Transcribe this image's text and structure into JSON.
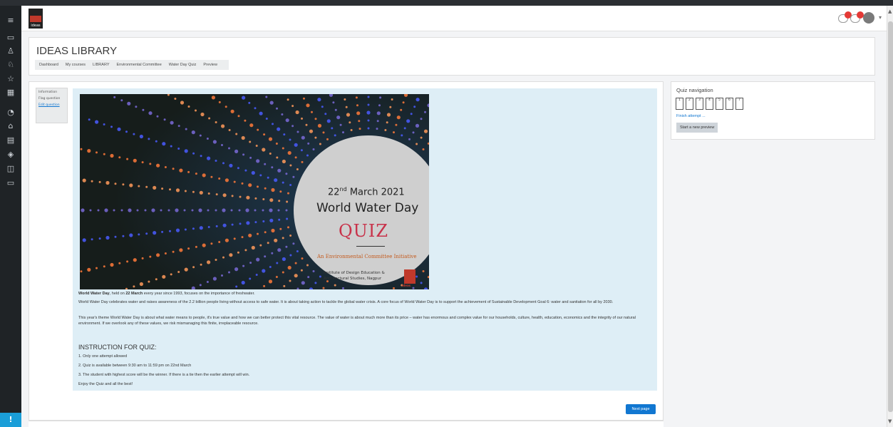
{
  "app": {
    "title": "IDEAS LIBRARY",
    "logo_text": "ideas"
  },
  "breadcrumb": [
    "Dashboard",
    "My courses",
    "LIBRARY",
    "Environmental Committee",
    "Water Day Quiz",
    "Preview"
  ],
  "question_info": {
    "title": "Information",
    "flag": "Flag question",
    "edit": "Edit question"
  },
  "poster": {
    "date_day": "22",
    "date_sup": "nd",
    "date_rest": " March 2021",
    "title": "World Water Day",
    "quiz": "QUIZ",
    "initiative": "An Environmental Committee Initiative",
    "institute_line1": "Institute of Design Education &",
    "institute_line2": "Architectural Studies, Nagpur",
    "logo_text": "ideas"
  },
  "content": {
    "p1_bold_a": "World Water Day",
    "p1_mid": ", held on ",
    "p1_bold_b": "22 March",
    "p1_rest": " every year since 1993, focuses on the importance of freshwater.",
    "p2": "World Water Day celebrates water and raises awareness of the 2.2 billion people living without access to safe water. It is about taking action to tackle the global water crisis. A core focus of World Water Day is to support the achievement of Sustainable Development Goal 6: water and sanitation for all by 2030.",
    "p3": "This year's theme World Water Day is about what water means to people, it's true value and how we can better protect this vital resource. The value of water is about much more than its price – water has enormous and complex value for our households, culture, health, education, economics and the integrity of our natural environment. If we overlook any of these values, we risk mismanaging this finite, irreplaceable resource.",
    "instructions_heading": "INSTRUCTION FOR QUIZ:",
    "instructions": [
      "1. Only one attempt allowed",
      "2. Quiz is available between 9:30 am to 11:59 pm on 22nd March",
      "3. The student with highest score will be the winner. If there is a tie then the earlier attempt will win.",
      "Enjoy the Quiz and all the best!"
    ]
  },
  "next_button": "Next page",
  "quiz_navigation": {
    "title": "Quiz navigation",
    "questions": [
      "1",
      "2",
      "3",
      "4",
      "5",
      "6",
      "7"
    ],
    "finish": "Finish attempt ...",
    "start_new": "Start a new preview"
  },
  "sidebar_icons": [
    "menu-icon",
    "folder-icon",
    "badge-icon",
    "collection-icon",
    "star-icon",
    "grid-icon",
    "dashboard-icon",
    "home-icon",
    "calendar-icon",
    "graduation-cap-icon",
    "files-icon",
    "box-icon"
  ],
  "colors": {
    "sidebar": "#1f2326",
    "accent": "#1177d1",
    "content_bg": "#deeef6",
    "notification": "#e53935"
  }
}
